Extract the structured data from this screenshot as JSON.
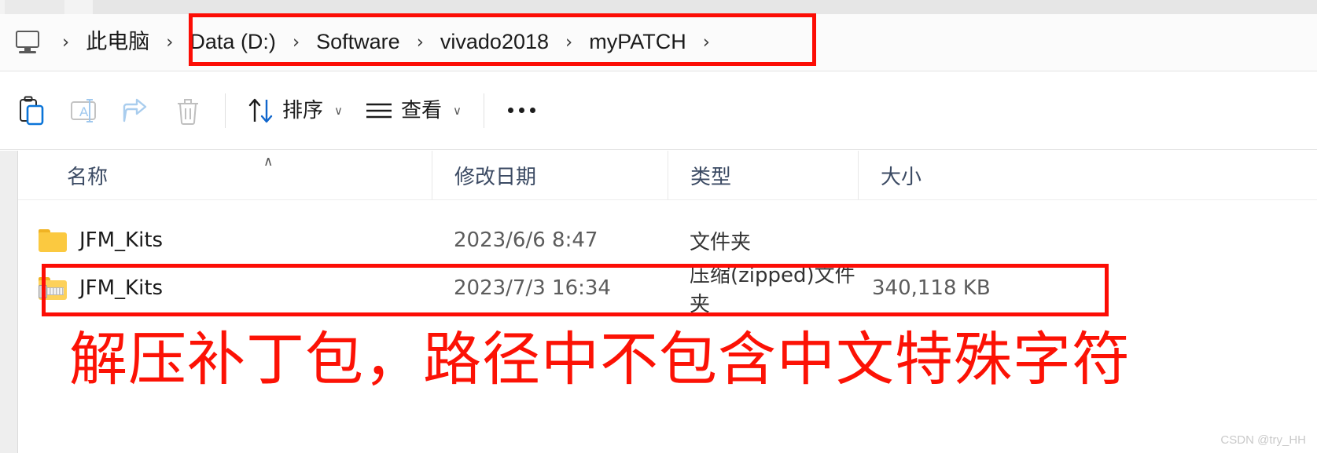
{
  "window": {
    "tabstrip_visible": true
  },
  "address_bar": {
    "root_icon": "this-pc-icon",
    "separator": "›",
    "crumbs": [
      {
        "label": "此电脑",
        "highlighted": false
      },
      {
        "label": "Data (D:)",
        "highlighted": true
      },
      {
        "label": "Software",
        "highlighted": true
      },
      {
        "label": "vivado2018",
        "highlighted": true
      },
      {
        "label": "myPATCH",
        "highlighted": true
      }
    ],
    "highlight_color": "#fc0d05"
  },
  "toolbar": {
    "buttons": [
      {
        "name": "paste",
        "icon": "paste-icon",
        "enabled": true
      },
      {
        "name": "rename",
        "icon": "rename-icon",
        "enabled": false
      },
      {
        "name": "share",
        "icon": "share-icon",
        "enabled": false
      },
      {
        "name": "delete",
        "icon": "trash-icon",
        "enabled": false
      }
    ],
    "sort_label": "排序",
    "view_label": "查看",
    "caret": "∨",
    "overflow_label": "•••"
  },
  "file_list": {
    "columns": [
      {
        "key": "name",
        "label": "名称"
      },
      {
        "key": "date",
        "label": "修改日期"
      },
      {
        "key": "type",
        "label": "类型"
      },
      {
        "key": "size",
        "label": "大小"
      }
    ],
    "sort_indicator": "∧",
    "rows": [
      {
        "icon": "folder-icon",
        "name": "JFM_Kits",
        "date": "2023/6/6 8:47",
        "type": "文件夹",
        "size": "",
        "highlighted": false
      },
      {
        "icon": "zipped-folder-icon",
        "name": "JFM_Kits",
        "date": "2023/7/3 16:34",
        "type": "压缩(zipped)文件夹",
        "size": "340,118 KB",
        "highlighted": true
      }
    ]
  },
  "annotation": {
    "text": "解压补丁包，路径中不包含中文特殊字符",
    "color": "#fc1205"
  },
  "watermark": {
    "text": "CSDN @try_HH"
  }
}
